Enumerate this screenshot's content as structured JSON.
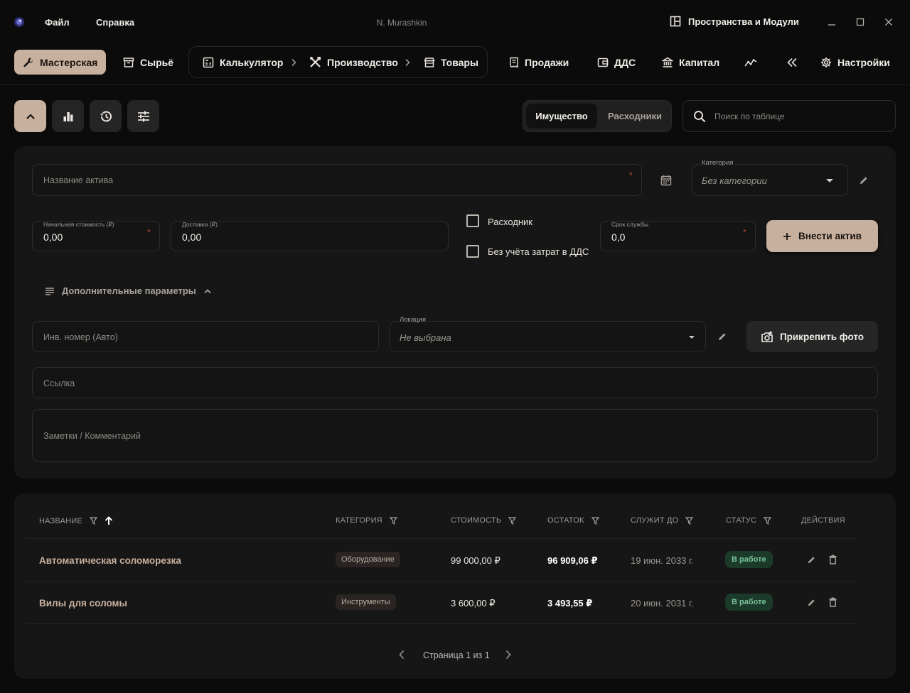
{
  "window": {
    "title": "N. Murashkin",
    "menu": [
      "Файл",
      "Справка"
    ],
    "spaces_label": "Пространства и Модули"
  },
  "nav": {
    "workshop": "Мастерская",
    "raw": "Сырьё",
    "calculator": "Калькулятор",
    "production": "Производство",
    "goods": "Товары",
    "sales": "Продажи",
    "dds": "ДДС",
    "capital": "Капитал",
    "settings": "Настройки"
  },
  "toolbar": {
    "segments": [
      "Имущество",
      "Расходники"
    ],
    "active_segment": "Имущество",
    "search_placeholder": "Поиск по таблице"
  },
  "form": {
    "asset_name_placeholder": "Название актива",
    "category_label": "Категория",
    "category_value": "Без категории",
    "initial_cost_label": "Начальная стоимость (₽)",
    "initial_cost_value": "0,00",
    "delivery_label": "Доставка (₽)",
    "delivery_value": "0,00",
    "consumable_label": "Расходник",
    "no_dds_label": "Без учёта затрат в ДДС",
    "service_life_label": "Срок службы",
    "service_life_value": "0,0",
    "submit_label": "Внести актив",
    "extra_params_label": "Дополнительные параметры",
    "inv_number_placeholder": "Инв. номер (Авто)",
    "location_label": "Локация",
    "location_value": "Не выбрана",
    "attach_photo_label": "Прикрепить фото",
    "link_placeholder": "Ссылка",
    "notes_placeholder": "Заметки / Комментарий"
  },
  "table": {
    "columns": [
      "НАЗВАНИЕ",
      "КАТЕГОРИЯ",
      "СТОИМОСТЬ",
      "ОСТАТОК",
      "СЛУЖИТ ДО",
      "СТАТУС",
      "ДЕЙСТВИЯ"
    ],
    "rows": [
      {
        "name": "Автоматическая соломорезка",
        "category": "Оборудование",
        "cost": "99 000,00 ₽",
        "remaining": "96 909,06 ₽",
        "until": "19 июн. 2033 г.",
        "status": "В работе"
      },
      {
        "name": "Вилы для соломы",
        "category": "Инструменты",
        "cost": "3 600,00 ₽",
        "remaining": "3 493,55 ₽",
        "until": "20 июн. 2031 г.",
        "status": "В работе"
      }
    ],
    "pagination": "Страница 1 из 1"
  },
  "colors": {
    "accent": "#c8b09e",
    "background": "#0b0b0b",
    "panel": "#161616",
    "status_ok": "#79c49a"
  }
}
